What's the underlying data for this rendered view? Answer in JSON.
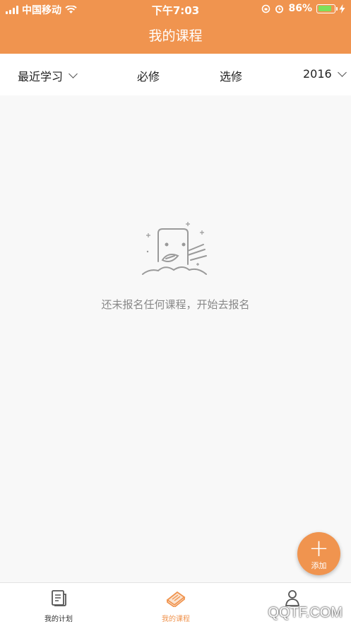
{
  "status_bar": {
    "carrier": "中国移动",
    "time": "下午7:03",
    "battery_percent": "86%",
    "battery_level": 0.86
  },
  "header": {
    "title": "我的课程"
  },
  "filters": {
    "recent": "最近学习",
    "required": "必修",
    "elective": "选修",
    "year": "2016"
  },
  "empty_state": {
    "message": "还未报名任何课程，开始去报名"
  },
  "fab": {
    "label": "添加"
  },
  "tabs": [
    {
      "label": "我的计划",
      "icon": "plan-icon"
    },
    {
      "label": "我的课程",
      "icon": "course-book-icon",
      "active": true
    },
    {
      "label": "",
      "icon": "profile-icon"
    }
  ],
  "watermark": "QQTF.COM",
  "colors": {
    "accent": "#f0944f",
    "background": "#f8f8f8"
  }
}
